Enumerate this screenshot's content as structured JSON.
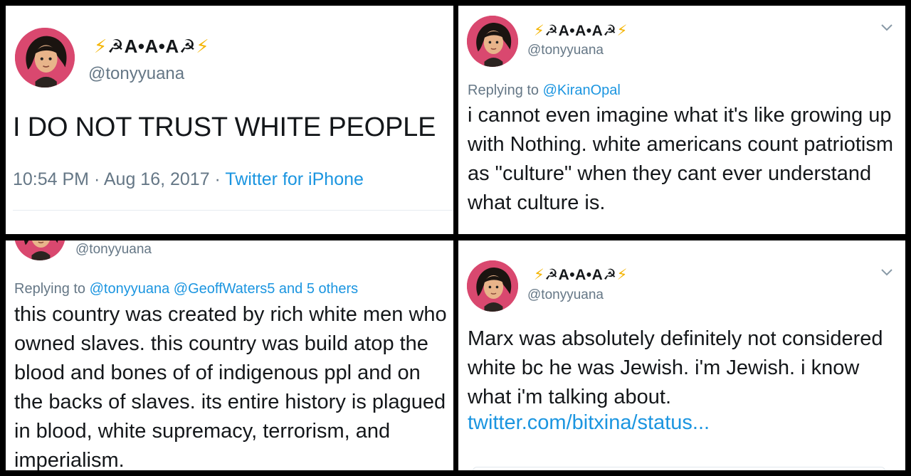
{
  "colors": {
    "background": "#000000",
    "panel": "#ffffff",
    "text": "#14171a",
    "muted": "#657786",
    "link": "#1b95e0",
    "bolt": "#f4b400",
    "avatar_bg": "#d9486f"
  },
  "user": {
    "display_name_bolt_left": "⚡",
    "display_name_core": "☭A•A•A☭",
    "display_name_bolt_right": "⚡",
    "handle": "@tonyyuana",
    "avatar_icon": "avatar-portrait-icon"
  },
  "tweet1": {
    "text": "I DO NOT TRUST WHITE PEOPLE",
    "time": "10:54 PM",
    "sep1": " · ",
    "date": "Aug 16, 2017",
    "sep2": " · ",
    "source": "Twitter for iPhone"
  },
  "tweet2": {
    "replying_prefix": "Replying to ",
    "replying_to": "@KiranOpal",
    "text": "i cannot even imagine what it's like growing up with Nothing. white americans count patriotism as \"culture\" when they cant ever understand what culture is.",
    "chevron_icon": "chevron-down-icon"
  },
  "tweet3": {
    "replying_prefix": "Replying to ",
    "replying_to": "@tonyyuana @GeoffWaters5 and 5 others",
    "text": "this country was created by rich white men who owned slaves. this country was build atop the blood and bones of of indigenous ppl and on the backs of slaves. its entire history is plagued in blood, white supremacy, terrorism, and imperialism."
  },
  "tweet4": {
    "text": "Marx was absolutely definitely not considered white bc he was Jewish. i'm Jewish. i know what i'm talking about.",
    "link": "twitter.com/bitxina/status...",
    "chevron_icon": "chevron-down-icon"
  }
}
